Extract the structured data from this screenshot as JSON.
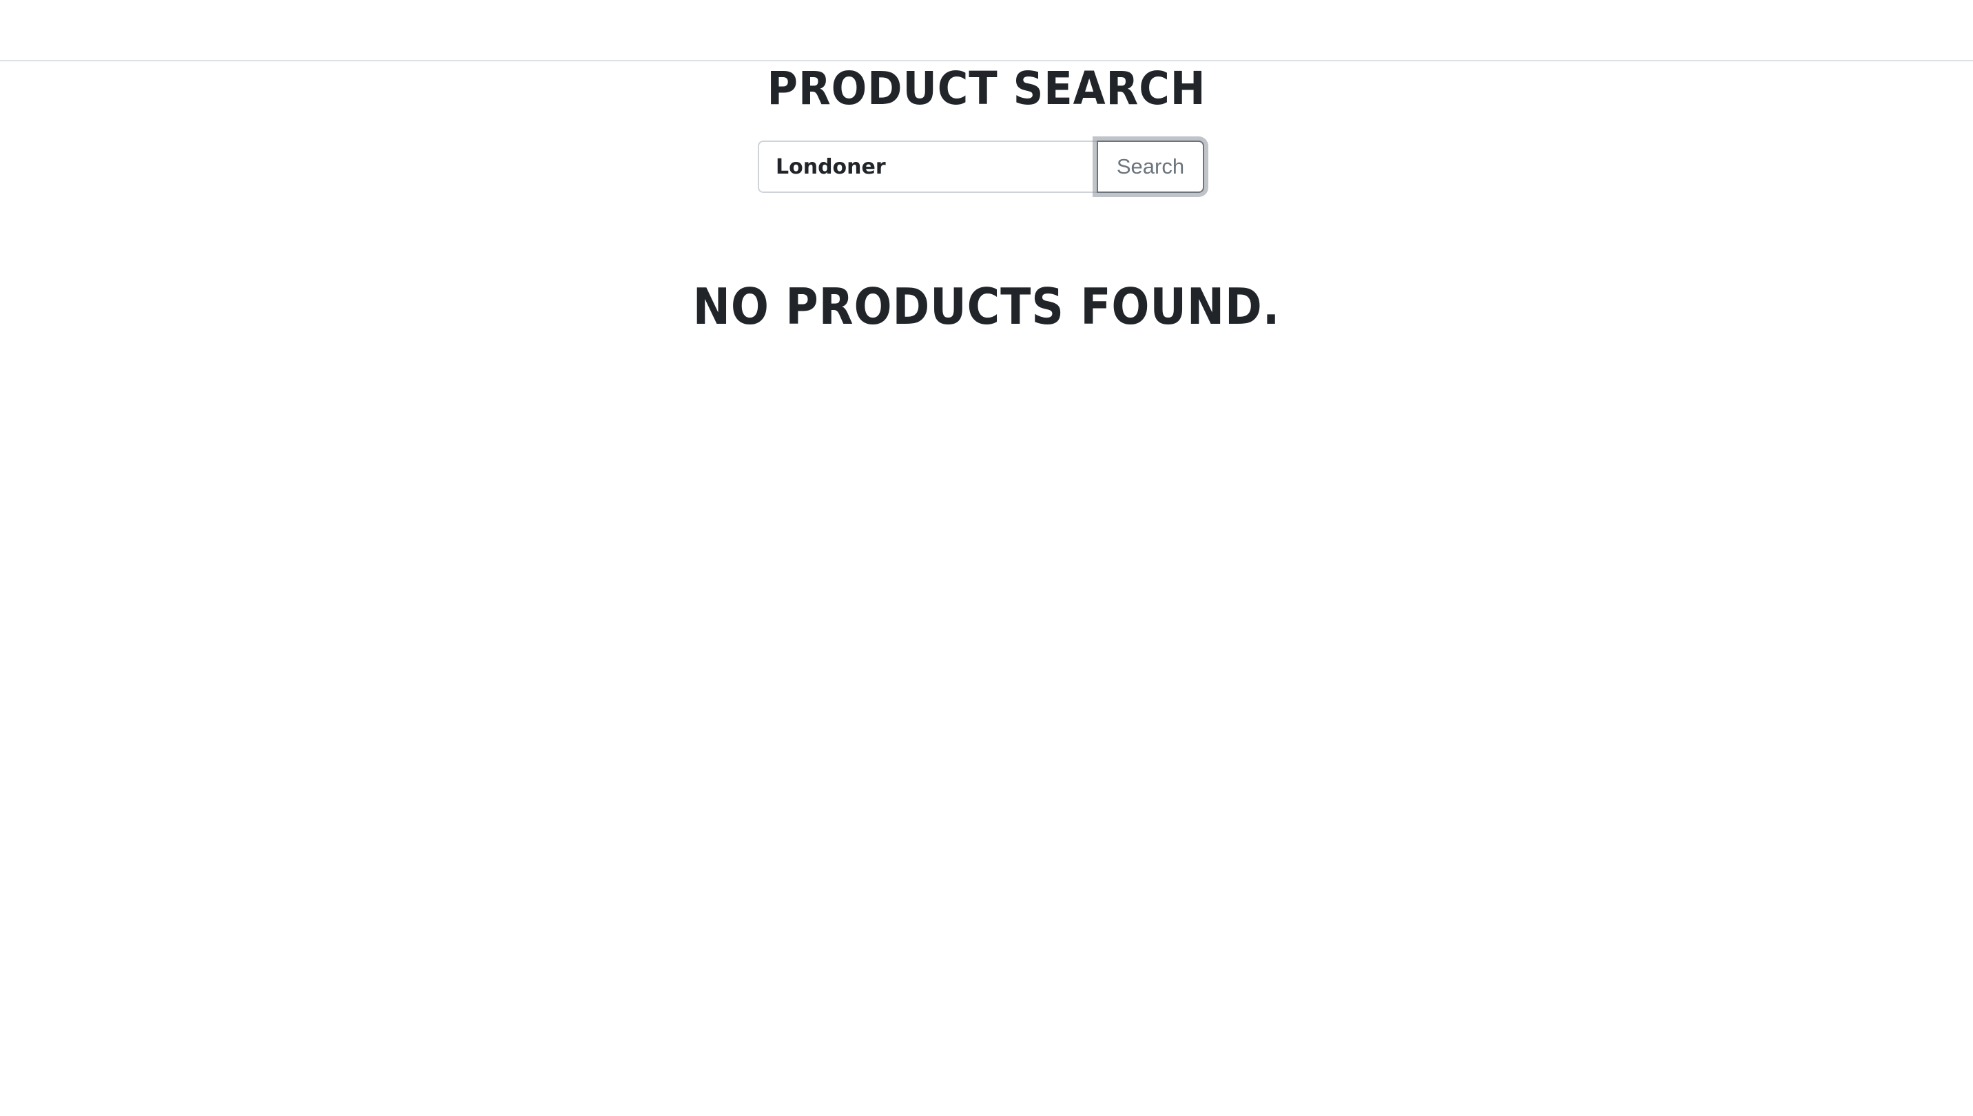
{
  "header": {
    "title": "Product Search"
  },
  "search": {
    "value": "Londoner",
    "button_label": "Search"
  },
  "results": {
    "empty_message": "No products found."
  },
  "colors": {
    "text": "#212529",
    "border": "#ced4da",
    "button_text": "#6c757d",
    "background": "#ffffff"
  }
}
